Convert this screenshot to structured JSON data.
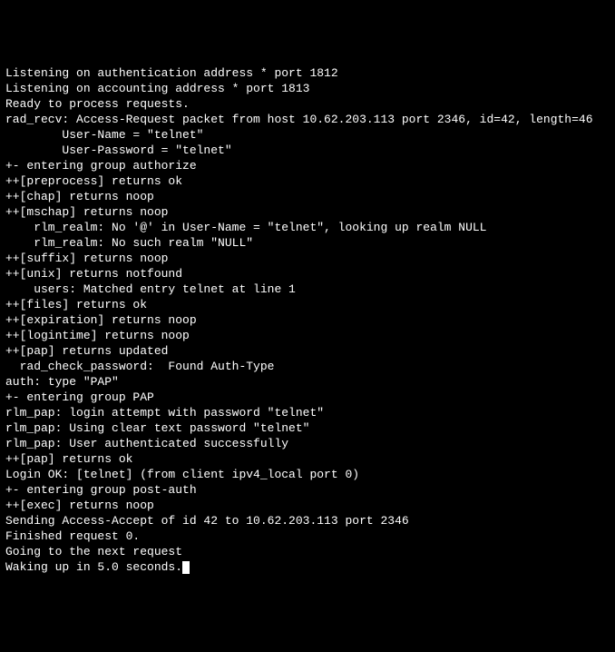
{
  "terminal": {
    "lines": [
      "Listening on authentication address * port 1812",
      "Listening on accounting address * port 1813",
      "Ready to process requests.",
      "rad_recv: Access-Request packet from host 10.62.203.113 port 2346, id=42, length=46",
      "        User-Name = \"telnet\"",
      "        User-Password = \"telnet\"",
      "+- entering group authorize",
      "++[preprocess] returns ok",
      "++[chap] returns noop",
      "++[mschap] returns noop",
      "    rlm_realm: No '@' in User-Name = \"telnet\", looking up realm NULL",
      "    rlm_realm: No such realm \"NULL\"",
      "++[suffix] returns noop",
      "++[unix] returns notfound",
      "    users: Matched entry telnet at line 1",
      "++[files] returns ok",
      "++[expiration] returns noop",
      "++[logintime] returns noop",
      "++[pap] returns updated",
      "  rad_check_password:  Found Auth-Type ",
      "auth: type \"PAP\"",
      "+- entering group PAP",
      "rlm_pap: login attempt with password \"telnet\"",
      "rlm_pap: Using clear text password \"telnet\"",
      "rlm_pap: User authenticated successfully",
      "++[pap] returns ok",
      "Login OK: [telnet] (from client ipv4_local port 0)",
      "+- entering group post-auth",
      "++[exec] returns noop",
      "Sending Access-Accept of id 42 to 10.62.203.113 port 2346",
      "Finished request 0.",
      "Going to the next request",
      "Waking up in 5.0 seconds."
    ]
  }
}
